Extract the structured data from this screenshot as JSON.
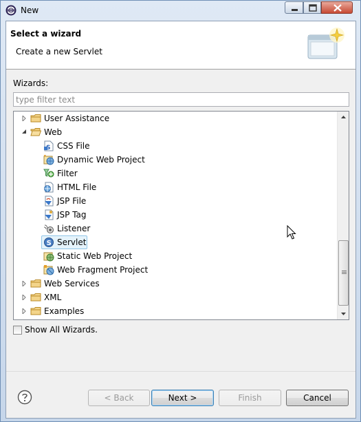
{
  "window": {
    "title": "New"
  },
  "banner": {
    "title": "Select a wizard",
    "description": "Create a new Servlet"
  },
  "wizards_label": "Wizards:",
  "filter": {
    "value": "",
    "placeholder": "type filter text"
  },
  "tree": {
    "items": [
      {
        "label": "User Assistance",
        "icon": "folder-icon",
        "expanded": false
      },
      {
        "label": "Web",
        "icon": "folder-icon",
        "expanded": true
      },
      {
        "label": "CSS File",
        "icon": "css-file-icon"
      },
      {
        "label": "Dynamic Web Project",
        "icon": "web-project-icon"
      },
      {
        "label": "Filter",
        "icon": "filter-icon"
      },
      {
        "label": "HTML File",
        "icon": "html-file-icon"
      },
      {
        "label": "JSP File",
        "icon": "jsp-file-icon"
      },
      {
        "label": "JSP Tag",
        "icon": "jsp-tag-icon"
      },
      {
        "label": "Listener",
        "icon": "listener-icon"
      },
      {
        "label": "Servlet",
        "icon": "servlet-icon",
        "selected": true
      },
      {
        "label": "Static Web Project",
        "icon": "static-web-project-icon"
      },
      {
        "label": "Web Fragment Project",
        "icon": "web-fragment-project-icon"
      },
      {
        "label": "Web Services",
        "icon": "folder-icon",
        "expanded": false
      },
      {
        "label": "XML",
        "icon": "folder-icon",
        "expanded": false
      },
      {
        "label": "Examples",
        "icon": "folder-icon",
        "expanded": false
      }
    ]
  },
  "show_all": {
    "label": "Show All Wizards.",
    "checked": false
  },
  "buttons": {
    "back": "< Back",
    "next": "Next >",
    "finish": "Finish",
    "cancel": "Cancel"
  }
}
